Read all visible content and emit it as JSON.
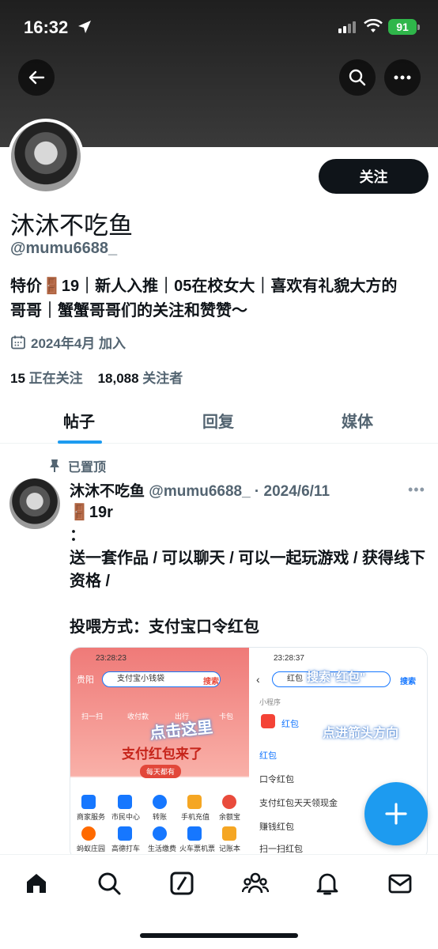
{
  "status_bar": {
    "time": "16:32",
    "battery": "91"
  },
  "profile": {
    "display_name": "沐沐不吃鱼",
    "handle": "@mumu6688_",
    "follow_label": "关注",
    "bio_line1": "特价🚪19｜新人入推｜05在校女大｜喜欢有礼貌大方的",
    "bio_line2": "哥哥｜蟹蟹哥哥们的关注和赞赞～",
    "joined": "2024年4月 加入",
    "following_count": "15",
    "following_label": "正在关注",
    "followers_count": "18,088",
    "followers_label": "关注者"
  },
  "tabs": {
    "posts": "帖子",
    "replies": "回复",
    "media": "媒体"
  },
  "pinned_post": {
    "pinned_label": "已置顶",
    "author": "沐沐不吃鱼",
    "meta": "@mumu6688_ · 2024/6/11",
    "text": "🚪19r\n：\n送一套作品 / 可以聊天 / 可以一起玩游戏 / 获得线下资格 /\n\n投喂方式：支付宝口令红包",
    "image": {
      "left_time": "23:28:23",
      "left_city": "贵阳",
      "left_search": "支付宝小钱袋",
      "left_search_btn": "搜索",
      "left_quick": [
        "扫一扫",
        "收付款",
        "出行",
        "卡包"
      ],
      "left_overlay": "点击这里",
      "left_banner": "支付红包来了",
      "left_pill": "每天都有",
      "left_grid": [
        "商家服务",
        "市民中心",
        "转账",
        "手机充值",
        "余额宝",
        "蚂蚁庄园",
        "高德打车",
        "生活缴费",
        "火车票机票",
        "记账本"
      ],
      "right_time": "23:28:37",
      "right_search": "红包",
      "right_overlay_top": "搜索\"红包\"",
      "right_search_btn": "搜索",
      "right_section": "小程序",
      "right_miniapp": "红包",
      "right_overlay": "点进箭头方向",
      "right_items": [
        "红包",
        "口令红包",
        "支付红包天天领现金",
        "赚钱红包",
        "扫一扫红包"
      ]
    }
  },
  "colors": {
    "accent": "#1d9bf0",
    "text": "#0f1419",
    "secondary": "#536471"
  }
}
